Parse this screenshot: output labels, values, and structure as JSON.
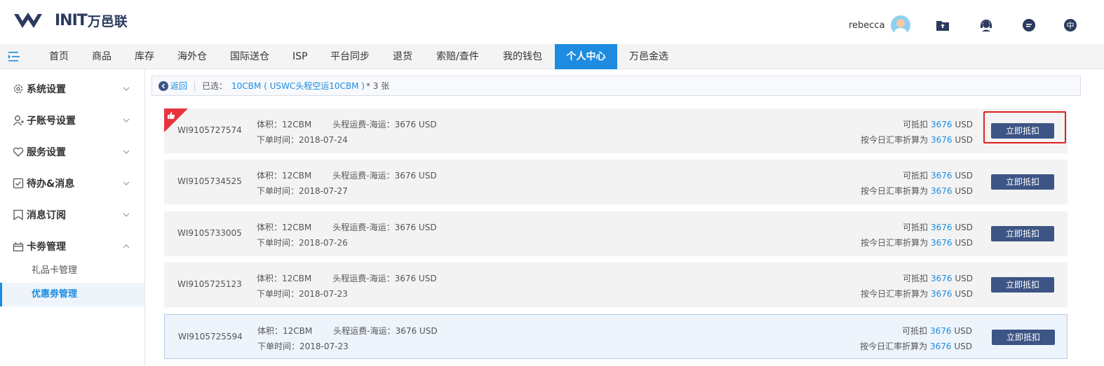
{
  "header": {
    "logo_text": "INIT",
    "logo_cn": "万邑联",
    "username": "rebecca",
    "icons": [
      "upload-folder-icon",
      "support-headset-icon",
      "chat-bubble-icon",
      "language-zh-icon"
    ],
    "lang_glyph": "中"
  },
  "nav": {
    "items": [
      "首页",
      "商品",
      "库存",
      "海外仓",
      "国际送仓",
      "ISP",
      "平台同步",
      "退货",
      "索赔/查件",
      "我的钱包",
      "个人中心",
      "万邑金选"
    ],
    "active": "个人中心"
  },
  "sidebar": {
    "groups": [
      {
        "label": "系统设置",
        "icon": "gear-icon"
      },
      {
        "label": "子账号设置",
        "icon": "user-icon"
      },
      {
        "label": "服务设置",
        "icon": "heart-icon"
      },
      {
        "label": "待办&消息",
        "icon": "checkbox-icon"
      },
      {
        "label": "消息订阅",
        "icon": "bookmark-icon"
      },
      {
        "label": "卡劵管理",
        "icon": "gift-icon"
      }
    ],
    "sub_items": [
      "礼品卡管理",
      "优惠劵管理"
    ],
    "active_sub": "优惠劵管理"
  },
  "crumb": {
    "back": "返回",
    "selected_label": "已选：",
    "selected_value": "10CBM ( USWC头程空运10CBM )",
    "selected_count": "* 3 张"
  },
  "cards": [
    {
      "id": "WI9105727574",
      "volume": "体积：12CBM",
      "freight": "头程运费-海运：3676 USD",
      "date": "下单时间：2018-07-24",
      "deduct_label": "可抵扣",
      "deduct_value": "3676",
      "deduct_unit": "USD",
      "rate_label": "按今日汇率折算为",
      "rate_value": "3676",
      "rate_unit": "USD",
      "button": "立即抵扣"
    },
    {
      "id": "WI9105734525",
      "volume": "体积：12CBM",
      "freight": "头程运费-海运：3676 USD",
      "date": "下单时间：2018-07-27",
      "deduct_label": "可抵扣",
      "deduct_value": "3676",
      "deduct_unit": "USD",
      "rate_label": "按今日汇率折算为",
      "rate_value": "3676",
      "rate_unit": "USD",
      "button": "立即抵扣"
    },
    {
      "id": "WI9105733005",
      "volume": "体积：12CBM",
      "freight": "头程运费-海运：3676 USD",
      "date": "下单时间：2018-07-26",
      "deduct_label": "可抵扣",
      "deduct_value": "3676",
      "deduct_unit": "USD",
      "rate_label": "按今日汇率折算为",
      "rate_value": "3676",
      "rate_unit": "USD",
      "button": "立即抵扣"
    },
    {
      "id": "WI9105725123",
      "volume": "体积：12CBM",
      "freight": "头程运费-海运：3676 USD",
      "date": "下单时间：2018-07-23",
      "deduct_label": "可抵扣",
      "deduct_value": "3676",
      "deduct_unit": "USD",
      "rate_label": "按今日汇率折算为",
      "rate_value": "3676",
      "rate_unit": "USD",
      "button": "立即抵扣"
    },
    {
      "id": "WI9105725594",
      "volume": "体积：12CBM",
      "freight": "头程运费-海运：3676 USD",
      "date": "下单时间：2018-07-23",
      "deduct_label": "可抵扣",
      "deduct_value": "3676",
      "deduct_unit": "USD",
      "rate_label": "按今日汇率折算为",
      "rate_value": "3676",
      "rate_unit": "USD",
      "button": "立即抵扣"
    }
  ],
  "colors": {
    "accent": "#1d8ce0",
    "button": "#3d5585",
    "highlight_border": "#e02020",
    "recommend_corner": "#e8343f"
  }
}
